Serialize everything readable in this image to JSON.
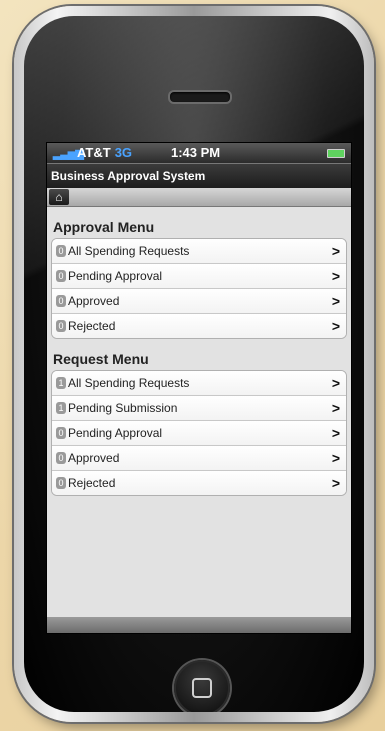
{
  "status_bar": {
    "carrier": "AT&T",
    "network": "3G",
    "time": "1:43 PM"
  },
  "app": {
    "title": "Business Approval System"
  },
  "approval_menu": {
    "title": "Approval Menu",
    "items": [
      {
        "count": "0",
        "label": "All Spending Requests"
      },
      {
        "count": "0",
        "label": "Pending Approval"
      },
      {
        "count": "0",
        "label": "Approved"
      },
      {
        "count": "0",
        "label": "Rejected"
      }
    ]
  },
  "request_menu": {
    "title": "Request Menu",
    "items": [
      {
        "count": "1",
        "label": "All Spending Requests"
      },
      {
        "count": "1",
        "label": "Pending Submission"
      },
      {
        "count": "0",
        "label": "Pending Approval"
      },
      {
        "count": "0",
        "label": "Approved"
      },
      {
        "count": "0",
        "label": "Rejected"
      }
    ]
  },
  "icons": {
    "home": "home-icon",
    "chevron": "chevron-right-icon"
  },
  "chevron_glyph": ">",
  "colors": {
    "network": "#4aa3ff",
    "battery": "#5fd35f"
  }
}
